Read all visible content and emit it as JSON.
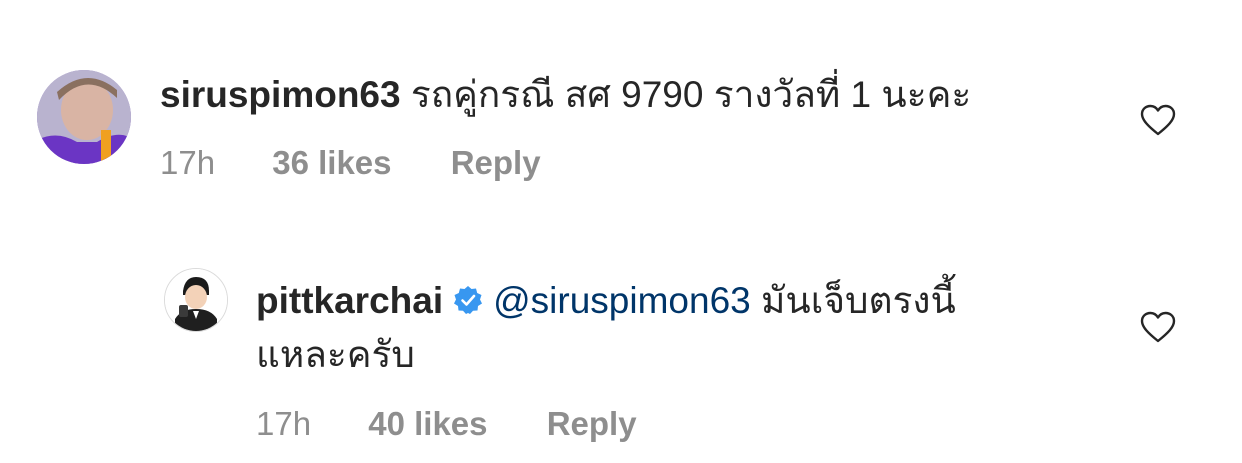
{
  "comments": [
    {
      "username": "siruspimon63",
      "text": "รถคู่กรณี สศ 9790  รางวัลที่ 1 นะคะ",
      "time": "17h",
      "likes": "36 likes",
      "reply": "Reply"
    },
    {
      "username": "pittkarchai",
      "mention": "@siruspimon63",
      "text_line1": " มันเจ็บตรงนี้",
      "text_line2": "แหละครับ",
      "time": "17h",
      "likes": "40 likes",
      "reply": "Reply"
    }
  ],
  "colors": {
    "text": "#262626",
    "meta": "#8e8e8e",
    "mention": "#003569",
    "verified": "#3897f0"
  },
  "icons": [
    "heart-icon",
    "verified-badge-icon",
    "avatar"
  ]
}
